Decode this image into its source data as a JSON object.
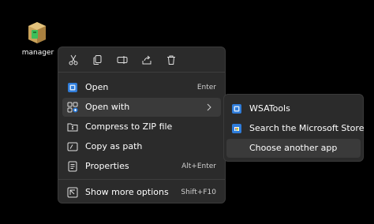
{
  "desktop": {
    "icon_label": "manager",
    "icon": "package-icon"
  },
  "context_menu": {
    "quick_actions": [
      {
        "name": "cut",
        "icon": "scissors-icon"
      },
      {
        "name": "copy",
        "icon": "copy-icon"
      },
      {
        "name": "rename",
        "icon": "rename-icon"
      },
      {
        "name": "share",
        "icon": "share-icon"
      },
      {
        "name": "delete",
        "icon": "trash-icon"
      }
    ],
    "items": [
      {
        "label": "Open",
        "shortcut": "Enter",
        "icon": "app-icon"
      },
      {
        "label": "Open with",
        "shortcut": "",
        "icon": "open-with-icon",
        "has_submenu": true
      },
      {
        "label": "Compress to ZIP file",
        "shortcut": "",
        "icon": "zip-icon"
      },
      {
        "label": "Copy as path",
        "shortcut": "",
        "icon": "path-icon"
      },
      {
        "label": "Properties",
        "shortcut": "Alt+Enter",
        "icon": "properties-icon"
      },
      {
        "label": "Show more options",
        "shortcut": "Shift+F10",
        "icon": "more-options-icon"
      }
    ]
  },
  "submenu": {
    "items": [
      {
        "label": "WSATools",
        "icon": "wsatools-icon"
      },
      {
        "label": "Search the Microsoft Store",
        "icon": "store-icon"
      },
      {
        "label": "Choose another app",
        "icon": ""
      }
    ]
  },
  "colors": {
    "background": "#000000",
    "menu_bg": "#2b2b2b",
    "hover_bg": "#3a3a3a",
    "accent": "#2f7cd9"
  }
}
